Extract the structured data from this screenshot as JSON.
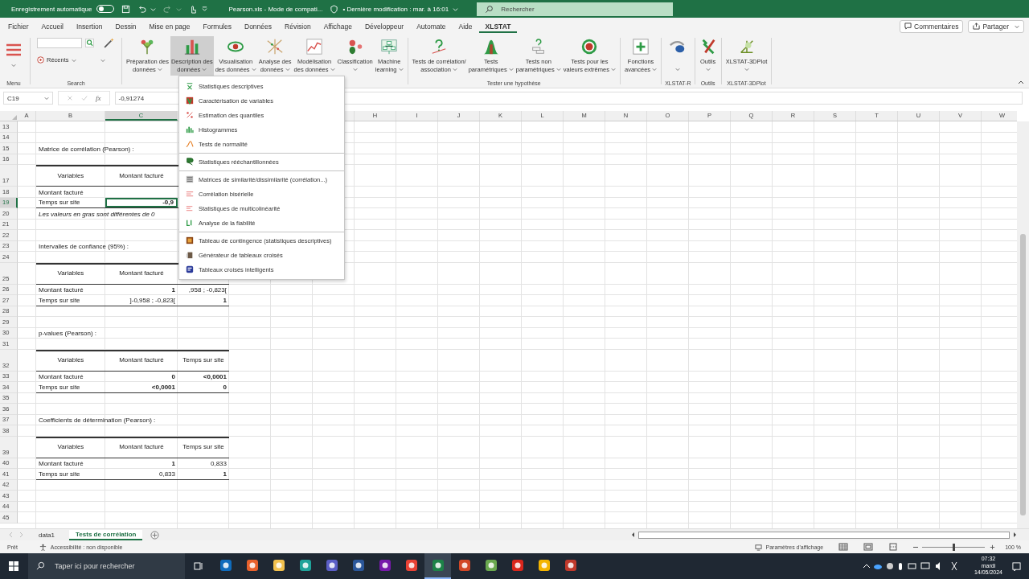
{
  "title_bar": {
    "autosave_label": "Enregistrement automatique",
    "autosave_on": false,
    "document": "Pearson.xls  -  Mode de compati...",
    "modified": "• Dernière modification : mar. à 16:01",
    "search_placeholder": "Rechercher"
  },
  "menu_tabs": [
    {
      "label": "Fichier",
      "selected": false
    },
    {
      "label": "Accueil",
      "selected": false
    },
    {
      "label": "Insertion",
      "selected": false
    },
    {
      "label": "Dessin",
      "selected": false
    },
    {
      "label": "Mise en page",
      "selected": false
    },
    {
      "label": "Formules",
      "selected": false
    },
    {
      "label": "Données",
      "selected": false
    },
    {
      "label": "Révision",
      "selected": false
    },
    {
      "label": "Affichage",
      "selected": false
    },
    {
      "label": "Développeur",
      "selected": false
    },
    {
      "label": "Automate",
      "selected": false
    },
    {
      "label": "Aide",
      "selected": false
    },
    {
      "label": "XLSTAT",
      "selected": true
    }
  ],
  "top_buttons": [
    "Commentaires",
    "Partager"
  ],
  "ribbon": {
    "menu_label": "Menu",
    "search_label": "Search",
    "recent_button": "Récents",
    "groups": [
      {
        "buttons": [
          {
            "lines": [
              "Préparation des",
              "données"
            ],
            "dropdown": true,
            "selected": false
          },
          {
            "lines": [
              "Description des",
              "données"
            ],
            "dropdown": true,
            "selected": true
          },
          {
            "lines": [
              "Visualisation",
              "des données"
            ],
            "dropdown": true,
            "selected": false
          },
          {
            "lines": [
              "Analyse des",
              "données"
            ],
            "dropdown": true,
            "selected": false
          },
          {
            "lines": [
              "Modélisation",
              "des données"
            ],
            "dropdown": true,
            "selected": false
          },
          {
            "lines": [
              "Classification"
            ],
            "dropdown": true,
            "selected": false
          },
          {
            "lines": [
              "Machine",
              "learning"
            ],
            "dropdown": true,
            "selected": false
          }
        ]
      },
      {
        "label": "Tester une hypothèse",
        "buttons": [
          {
            "lines": [
              "Tests de corrélation/",
              "association"
            ],
            "dropdown": true,
            "selected": false
          },
          {
            "lines": [
              "Tests",
              "paramétriques"
            ],
            "dropdown": true,
            "selected": false
          },
          {
            "lines": [
              "Tests non",
              "paramétriques"
            ],
            "dropdown": true,
            "selected": false
          },
          {
            "lines": [
              "Tests pour les",
              "valeurs extrêmes"
            ],
            "dropdown": true,
            "selected": false
          }
        ]
      },
      {
        "buttons": [
          {
            "lines": [
              "Fonctions",
              "avancées"
            ],
            "dropdown": true,
            "selected": false
          }
        ]
      },
      {
        "label": "XLSTAT-R",
        "buttons": [
          {
            "dropdown": true,
            "selected": false
          }
        ]
      },
      {
        "label": "Outils",
        "buttons": [
          {
            "lines": [
              "Outils"
            ],
            "dropdown": true,
            "selected": false
          }
        ]
      },
      {
        "label": "XLSTAT-3DPlot",
        "buttons": [
          {
            "lines": [
              "XLSTAT-3DPlot"
            ],
            "dropdown": true,
            "selected": false
          }
        ]
      }
    ]
  },
  "formula_bar": {
    "name_box": "C19",
    "fx": "fx",
    "formula": "-0,91274"
  },
  "columns": [
    {
      "label": "A",
      "selected": false
    },
    {
      "label": "B",
      "selected": false
    },
    {
      "label": "C",
      "selected": true
    },
    {
      "label": "H",
      "selected": false
    },
    {
      "label": "I",
      "selected": false
    },
    {
      "label": "J",
      "selected": false
    },
    {
      "label": "K",
      "selected": false
    },
    {
      "label": "L",
      "selected": false
    },
    {
      "label": "M",
      "selected": false
    },
    {
      "label": "N",
      "selected": false
    },
    {
      "label": "O",
      "selected": false
    },
    {
      "label": "P",
      "selected": false
    },
    {
      "label": "Q",
      "selected": false
    },
    {
      "label": "R",
      "selected": false
    },
    {
      "label": "S",
      "selected": false
    },
    {
      "label": "T",
      "selected": false
    },
    {
      "label": "U",
      "selected": false
    },
    {
      "label": "V",
      "selected": false
    },
    {
      "label": "W",
      "selected": false
    }
  ],
  "rows": [
    {
      "number": "13",
      "kind": "blank",
      "selected": false
    },
    {
      "number": "14",
      "kind": "blank",
      "selected": false
    },
    {
      "number": "15",
      "kind": "title",
      "selected": false,
      "b": {
        "text": "Matrice de corrélation (Pearson) :"
      }
    },
    {
      "number": "16",
      "kind": "blank",
      "selected": false
    },
    {
      "number": "17",
      "kind": "header",
      "selected": false,
      "b": {
        "text": "Variables"
      },
      "c": {
        "text": "Montant facturé"
      }
    },
    {
      "number": "18",
      "kind": "data",
      "selected": false,
      "b": {
        "text": "Montant facturé"
      }
    },
    {
      "number": "19",
      "kind": "lastdata",
      "selected": true,
      "b": {
        "text": "Temps sur site"
      },
      "c": {
        "text": "-0,9",
        "bold": true
      }
    },
    {
      "number": "20",
      "kind": "note",
      "selected": false,
      "b": {
        "text": "Les valeurs en gras sont différentes de 0"
      }
    },
    {
      "number": "21",
      "kind": "blank",
      "selected": false
    },
    {
      "number": "22",
      "kind": "blank",
      "selected": false
    },
    {
      "number": "23",
      "kind": "title",
      "selected": false,
      "b": {
        "text": "Intervalles de confiance (95%) :"
      }
    },
    {
      "number": "24",
      "kind": "blank",
      "selected": false
    },
    {
      "number": "25",
      "kind": "header",
      "selected": false,
      "b": {
        "text": "Variables"
      },
      "c": {
        "text": "Montant facturé"
      }
    },
    {
      "number": "26",
      "kind": "data",
      "selected": false,
      "b": {
        "text": "Montant facturé"
      },
      "c": {
        "text": "1",
        "bold": true
      },
      "d": {
        "text": ",958 ; -0,823["
      }
    },
    {
      "number": "27",
      "kind": "lastdata",
      "selected": false,
      "b": {
        "text": "Temps sur site"
      },
      "c": {
        "text": "]-0,958 ; -0,823["
      },
      "d": {
        "text": "1",
        "bold": true
      }
    },
    {
      "number": "28",
      "kind": "blank",
      "selected": false
    },
    {
      "number": "29",
      "kind": "blank",
      "selected": false
    },
    {
      "number": "30",
      "kind": "title",
      "selected": false,
      "b": {
        "text": "p-values (Pearson) :"
      }
    },
    {
      "number": "31",
      "kind": "blank",
      "selected": false
    },
    {
      "number": "32",
      "kind": "header",
      "selected": false,
      "b": {
        "text": "Variables"
      },
      "c": {
        "text": "Montant facturé"
      },
      "d": {
        "text": "Temps sur site"
      }
    },
    {
      "number": "33",
      "kind": "data",
      "selected": false,
      "b": {
        "text": "Montant facturé"
      },
      "c": {
        "text": "0",
        "bold": true
      },
      "d": {
        "text": "<0,0001",
        "bold": true
      }
    },
    {
      "number": "34",
      "kind": "lastdata",
      "selected": false,
      "b": {
        "text": "Temps sur site"
      },
      "c": {
        "text": "<0,0001",
        "bold": true
      },
      "d": {
        "text": "0",
        "bold": true
      }
    },
    {
      "number": "35",
      "kind": "blank",
      "selected": false
    },
    {
      "number": "36",
      "kind": "blank",
      "selected": false
    },
    {
      "number": "37",
      "kind": "title",
      "selected": false,
      "b": {
        "text": "Coefficients de détermination (Pearson) :"
      }
    },
    {
      "number": "38",
      "kind": "blank",
      "selected": false
    },
    {
      "number": "39",
      "kind": "header",
      "selected": false,
      "b": {
        "text": "Variables"
      },
      "c": {
        "text": "Montant facturé"
      },
      "d": {
        "text": "Temps sur site"
      }
    },
    {
      "number": "40",
      "kind": "data",
      "selected": false,
      "b": {
        "text": "Montant facturé"
      },
      "c": {
        "text": "1",
        "bold": true
      },
      "d": {
        "text": "0,833"
      }
    },
    {
      "number": "41",
      "kind": "lastdata",
      "selected": false,
      "b": {
        "text": "Temps sur site"
      },
      "c": {
        "text": "0,833"
      },
      "d": {
        "text": "1",
        "bold": true
      }
    },
    {
      "number": "42",
      "kind": "blank",
      "selected": false
    },
    {
      "number": "43",
      "kind": "blank",
      "selected": false
    },
    {
      "number": "44",
      "kind": "blank",
      "selected": false
    },
    {
      "number": "45",
      "kind": "blank",
      "selected": false
    }
  ],
  "dropdown_menu": [
    {
      "label": "Statistiques descriptives",
      "separator_before": false
    },
    {
      "label": "Caractérisation de variables",
      "separator_before": false
    },
    {
      "label": "Estimation des quantiles",
      "separator_before": false
    },
    {
      "label": "Histogrammes",
      "separator_before": false
    },
    {
      "label": "Tests de normalité",
      "separator_before": false
    },
    {
      "label": "Statistiques rééchantillonnées",
      "separator_before": true
    },
    {
      "label": "Matrices de similarité/dissimilarité (corrélation...)",
      "separator_before": true
    },
    {
      "label": "Corrélation bisérielle",
      "separator_before": false
    },
    {
      "label": "Statistiques de multicolinéarité",
      "separator_before": false
    },
    {
      "label": "Analyse de la fiabilité",
      "separator_before": false
    },
    {
      "label": "Tableau de contingence (statistiques descriptives)",
      "separator_before": true
    },
    {
      "label": "Générateur de tableaux croisés",
      "separator_before": false
    },
    {
      "label": "Tableaux croisés intelligents",
      "separator_before": false
    }
  ],
  "sheet_tabs": [
    {
      "label": "data1",
      "selected": false
    },
    {
      "label": "Tests de corrélation",
      "selected": true
    }
  ],
  "status_bar": {
    "ready": "Prêt",
    "accessibility": "Accessibilité : non disponible",
    "display_settings": "Paramètres d'affichage",
    "zoom": "100 %",
    "zoom_slider": {
      "level": 0.5
    }
  },
  "taskbar": {
    "search_placeholder": "Taper ici pour rechercher",
    "apps": [
      {
        "color": "#0f6cbd",
        "selected": false
      },
      {
        "color": "#e8612c",
        "selected": false
      },
      {
        "color": "#f2c14e",
        "selected": false
      },
      {
        "color": "#1fa39a",
        "selected": false
      },
      {
        "color": "#5b5fc7",
        "selected": false
      },
      {
        "color": "#2b579a",
        "selected": false
      },
      {
        "color": "#7719aa",
        "selected": false
      },
      {
        "color": "#e94235",
        "selected": false
      },
      {
        "color": "#1d8348",
        "selected": true
      },
      {
        "color": "#d24726",
        "selected": false
      },
      {
        "color": "#6aa84f",
        "selected": false
      },
      {
        "color": "#d9261c",
        "selected": false
      },
      {
        "color": "#f4b400",
        "selected": false
      },
      {
        "color": "#c0392b",
        "selected": false
      }
    ],
    "time": "07:32",
    "day": "mardi",
    "date": "14/05/2024"
  }
}
